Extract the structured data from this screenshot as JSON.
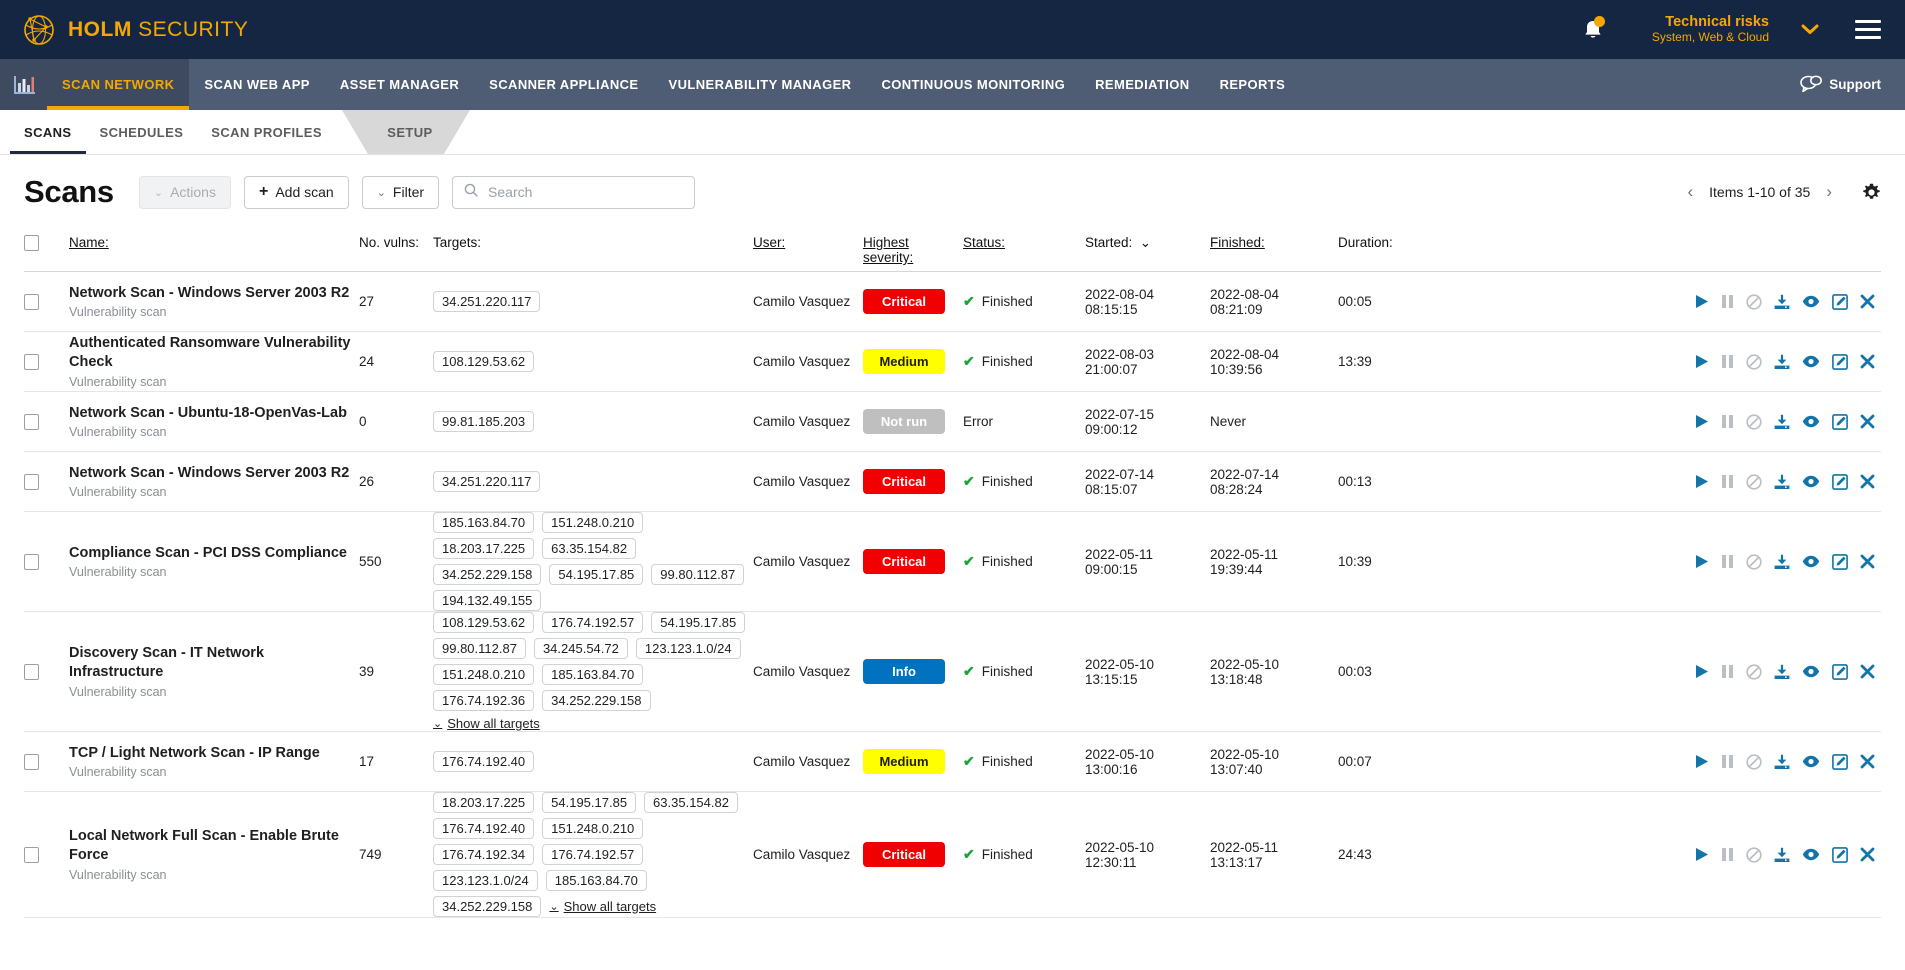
{
  "topbar": {
    "brand_bold": "HOLM",
    "brand_light": "SECURITY",
    "logo_icon": "globe-network-icon",
    "bell_icon": "notification-bell-icon",
    "org_name": "Technical risks",
    "org_sub": "System, Web & Cloud",
    "caret_icon": "chevron-down-icon",
    "menu_icon": "hamburger-menu-icon",
    "bg_color": "#152642",
    "accent_color": "#f5a800"
  },
  "mainnav": {
    "dashboard_icon": "bar-chart-icon",
    "items": [
      {
        "label": "SCAN NETWORK",
        "active": true
      },
      {
        "label": "SCAN WEB APP",
        "active": false
      },
      {
        "label": "ASSET MANAGER",
        "active": false
      },
      {
        "label": "SCANNER APPLIANCE",
        "active": false
      },
      {
        "label": "VULNERABILITY MANAGER",
        "active": false
      },
      {
        "label": "CONTINUOUS MONITORING",
        "active": false
      },
      {
        "label": "REMEDIATION",
        "active": false
      },
      {
        "label": "REPORTS",
        "active": false
      }
    ],
    "support_label": "Support",
    "support_icon": "chat-bubbles-icon"
  },
  "subnav": {
    "items": [
      {
        "label": "SCANS",
        "active": true
      },
      {
        "label": "SCHEDULES",
        "active": false
      },
      {
        "label": "SCAN PROFILES",
        "active": false
      }
    ],
    "tag": {
      "label": "SETUP"
    }
  },
  "toolbar": {
    "title": "Scans",
    "actions_label": "Actions",
    "add_scan_label": "Add scan",
    "filter_label": "Filter",
    "search_placeholder": "Search",
    "search_value": "",
    "search_icon": "search-icon",
    "pager_prev_icon": "chevron-left-icon",
    "pager_next_icon": "chevron-right-icon",
    "pager_label": "Items 1-10 of 35",
    "settings_icon": "gear-icon"
  },
  "table": {
    "headers": {
      "name": "Name:",
      "vulns": "No. vulns:",
      "targets": "Targets:",
      "user": "User:",
      "severity": "Highest severity:",
      "status": "Status:",
      "started": "Started:",
      "finished": "Finished:",
      "duration": "Duration:"
    },
    "sort_caret_icon": "chevron-down-icon",
    "show_all_label": "Show all targets",
    "row_actions": [
      {
        "name": "start-scan-icon",
        "label": "Start",
        "state": "active"
      },
      {
        "name": "pause-scan-icon",
        "label": "Pause",
        "state": "disabled"
      },
      {
        "name": "stop-scan-icon",
        "label": "Stop",
        "state": "disabled"
      },
      {
        "name": "download-report-icon",
        "label": "Download",
        "state": "active"
      },
      {
        "name": "view-scan-icon",
        "label": "View",
        "state": "active"
      },
      {
        "name": "edit-scan-icon",
        "label": "Edit",
        "state": "active"
      },
      {
        "name": "delete-scan-icon",
        "label": "Delete",
        "state": "active"
      }
    ],
    "rows": [
      {
        "name": "Network Scan - Windows Server 2003 R2",
        "type": "Vulnerability scan",
        "vulns": "27",
        "targets": [
          "34.251.220.117"
        ],
        "show_all": false,
        "user": "Camilo Vasquez",
        "severity": "Critical",
        "severity_class": "critical",
        "status": "Finished",
        "status_ok": true,
        "started": "2022-08-04 08:15:15",
        "finished": "2022-08-04 08:21:09",
        "duration": "00:05"
      },
      {
        "name": "Authenticated Ransomware Vulnerability Check",
        "type": "Vulnerability scan",
        "vulns": "24",
        "targets": [
          "108.129.53.62"
        ],
        "show_all": false,
        "user": "Camilo Vasquez",
        "severity": "Medium",
        "severity_class": "medium",
        "status": "Finished",
        "status_ok": true,
        "started": "2022-08-03 21:00:07",
        "finished": "2022-08-04 10:39:56",
        "duration": "13:39"
      },
      {
        "name": "Network Scan - Ubuntu-18-OpenVas-Lab",
        "type": "Vulnerability scan",
        "vulns": "0",
        "targets": [
          "99.81.185.203"
        ],
        "show_all": false,
        "user": "Camilo Vasquez",
        "severity": "Not run",
        "severity_class": "notrun",
        "status": "Error",
        "status_ok": false,
        "started": "2022-07-15 09:00:12",
        "finished": "Never",
        "duration": ""
      },
      {
        "name": "Network Scan - Windows Server 2003 R2",
        "type": "Vulnerability scan",
        "vulns": "26",
        "targets": [
          "34.251.220.117"
        ],
        "show_all": false,
        "user": "Camilo Vasquez",
        "severity": "Critical",
        "severity_class": "critical",
        "status": "Finished",
        "status_ok": true,
        "started": "2022-07-14 08:15:07",
        "finished": "2022-07-14 08:28:24",
        "duration": "00:13"
      },
      {
        "name": "Compliance Scan - PCI DSS Compliance",
        "type": "Vulnerability scan",
        "vulns": "550",
        "targets": [
          "185.163.84.70",
          "151.248.0.210",
          "18.203.17.225",
          "63.35.154.82",
          "34.252.229.158",
          "54.195.17.85",
          "99.80.112.87",
          "194.132.49.155"
        ],
        "show_all": false,
        "user": "Camilo Vasquez",
        "severity": "Critical",
        "severity_class": "critical",
        "status": "Finished",
        "status_ok": true,
        "started": "2022-05-11 09:00:15",
        "finished": "2022-05-11 19:39:44",
        "duration": "10:39"
      },
      {
        "name": "Discovery Scan - IT Network Infrastructure",
        "type": "Vulnerability scan",
        "vulns": "39",
        "targets": [
          "108.129.53.62",
          "176.74.192.57",
          "54.195.17.85",
          "99.80.112.87",
          "34.245.54.72",
          "123.123.1.0/24",
          "151.248.0.210",
          "185.163.84.70",
          "176.74.192.36",
          "34.252.229.158"
        ],
        "show_all": true,
        "user": "Camilo Vasquez",
        "severity": "Info",
        "severity_class": "info",
        "status": "Finished",
        "status_ok": true,
        "started": "2022-05-10 13:15:15",
        "finished": "2022-05-10 13:18:48",
        "duration": "00:03"
      },
      {
        "name": "TCP / Light Network Scan - IP Range",
        "type": "Vulnerability scan",
        "vulns": "17",
        "targets": [
          "176.74.192.40"
        ],
        "show_all": false,
        "user": "Camilo Vasquez",
        "severity": "Medium",
        "severity_class": "medium",
        "status": "Finished",
        "status_ok": true,
        "started": "2022-05-10 13:00:16",
        "finished": "2022-05-10 13:07:40",
        "duration": "00:07"
      },
      {
        "name": "Local Network Full Scan - Enable Brute Force",
        "type": "Vulnerability scan",
        "vulns": "749",
        "targets": [
          "18.203.17.225",
          "54.195.17.85",
          "63.35.154.82",
          "176.74.192.40",
          "151.248.0.210",
          "176.74.192.34",
          "176.74.192.57",
          "123.123.1.0/24",
          "185.163.84.70",
          "34.252.229.158"
        ],
        "show_all": true,
        "user": "Camilo Vasquez",
        "severity": "Critical",
        "severity_class": "critical",
        "status": "Finished",
        "status_ok": true,
        "started": "2022-05-10 12:30:11",
        "finished": "2022-05-11 13:13:17",
        "duration": "24:43"
      }
    ]
  }
}
